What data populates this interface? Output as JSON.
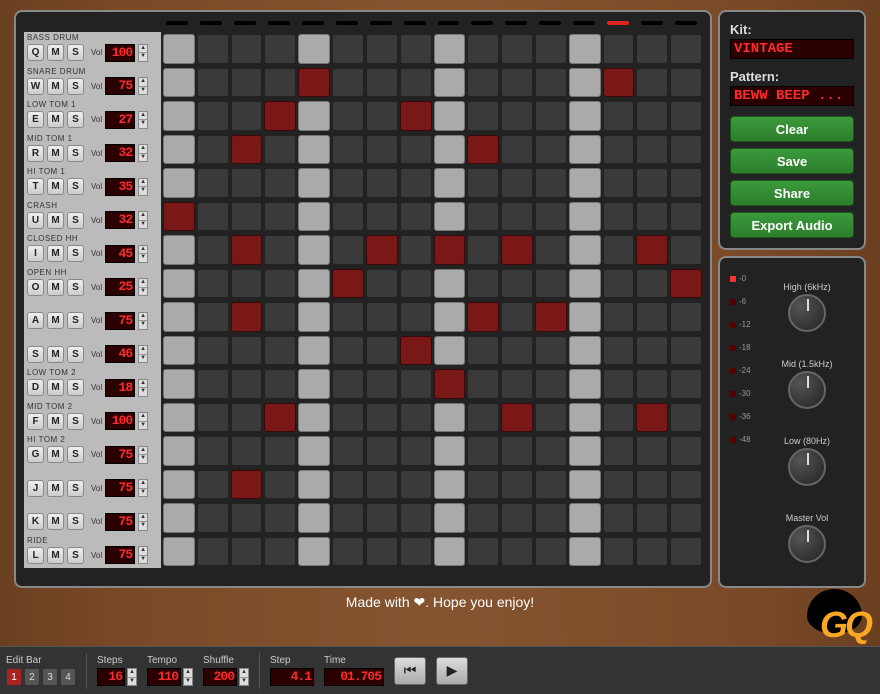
{
  "kit": {
    "label": "Kit:",
    "value": "VINTAGE"
  },
  "pattern": {
    "label": "Pattern:",
    "value": "BEWW BEEP ..."
  },
  "actions": {
    "clear": "Clear",
    "save": "Save",
    "share": "Share",
    "export": "Export Audio"
  },
  "eq": {
    "meter_labels": [
      "-0",
      "-6",
      "-12",
      "-18",
      "-24",
      "-30",
      "-36",
      "-48"
    ],
    "meter_on": 0,
    "knobs": [
      {
        "name": "High (6kHz)"
      },
      {
        "name": "Mid (1.5kHz)"
      },
      {
        "name": "Low (80Hz)"
      },
      {
        "name": "Master Vol"
      }
    ]
  },
  "tracks": [
    {
      "name": "BASS DRUM",
      "key": "Q",
      "vol": "100",
      "on": []
    },
    {
      "name": "SNARE DRUM",
      "key": "W",
      "vol": "75",
      "on": [
        4,
        13
      ]
    },
    {
      "name": "LOW TOM 1",
      "key": "E",
      "vol": "27",
      "on": [
        3,
        7
      ]
    },
    {
      "name": "MID TOM 1",
      "key": "R",
      "vol": "32",
      "on": [
        2,
        9
      ]
    },
    {
      "name": "HI TOM 1",
      "key": "T",
      "vol": "35",
      "on": []
    },
    {
      "name": "CRASH",
      "key": "U",
      "vol": "32",
      "on": [
        0
      ]
    },
    {
      "name": "CLOSED HH",
      "key": "I",
      "vol": "45",
      "on": [
        2,
        6,
        8,
        10,
        14
      ]
    },
    {
      "name": "OPEN HH",
      "key": "O",
      "vol": "25",
      "on": [
        5,
        15
      ]
    },
    {
      "name": "",
      "key": "A",
      "vol": "75",
      "on": [
        2,
        9,
        11
      ]
    },
    {
      "name": "",
      "key": "S",
      "vol": "46",
      "on": [
        7
      ]
    },
    {
      "name": "LOW TOM 2",
      "key": "D",
      "vol": "18",
      "on": [
        8
      ]
    },
    {
      "name": "MID TOM 2",
      "key": "F",
      "vol": "100",
      "on": [
        3,
        10,
        14
      ]
    },
    {
      "name": "HI TOM 2",
      "key": "G",
      "vol": "75",
      "on": []
    },
    {
      "name": "",
      "key": "J",
      "vol": "75",
      "on": [
        2
      ]
    },
    {
      "name": "",
      "key": "K",
      "vol": "75",
      "on": []
    },
    {
      "name": "RIDE",
      "key": "L",
      "vol": "75",
      "on": []
    }
  ],
  "steps_per_track": 16,
  "beat_marks": [
    0,
    4,
    8,
    12
  ],
  "tempo_light_on": 13,
  "footer": {
    "line1_a": "Made with ",
    "line1_b": ". Hope you enjoy!"
  },
  "logo": "GQ",
  "bottom": {
    "edit_bar": {
      "label": "Edit Bar",
      "active": 1,
      "buttons": [
        "1",
        "2",
        "3",
        "4"
      ]
    },
    "steps": {
      "label": "Steps",
      "value": "16"
    },
    "tempo": {
      "label": "Tempo",
      "value": "110"
    },
    "shuffle": {
      "label": "Shuffle",
      "value": "200"
    },
    "step": {
      "label": "Step",
      "value": "4.1"
    },
    "time": {
      "label": "Time",
      "value": "01.705"
    }
  },
  "labels": {
    "vol": "Vol",
    "m": "M",
    "s": "S"
  }
}
